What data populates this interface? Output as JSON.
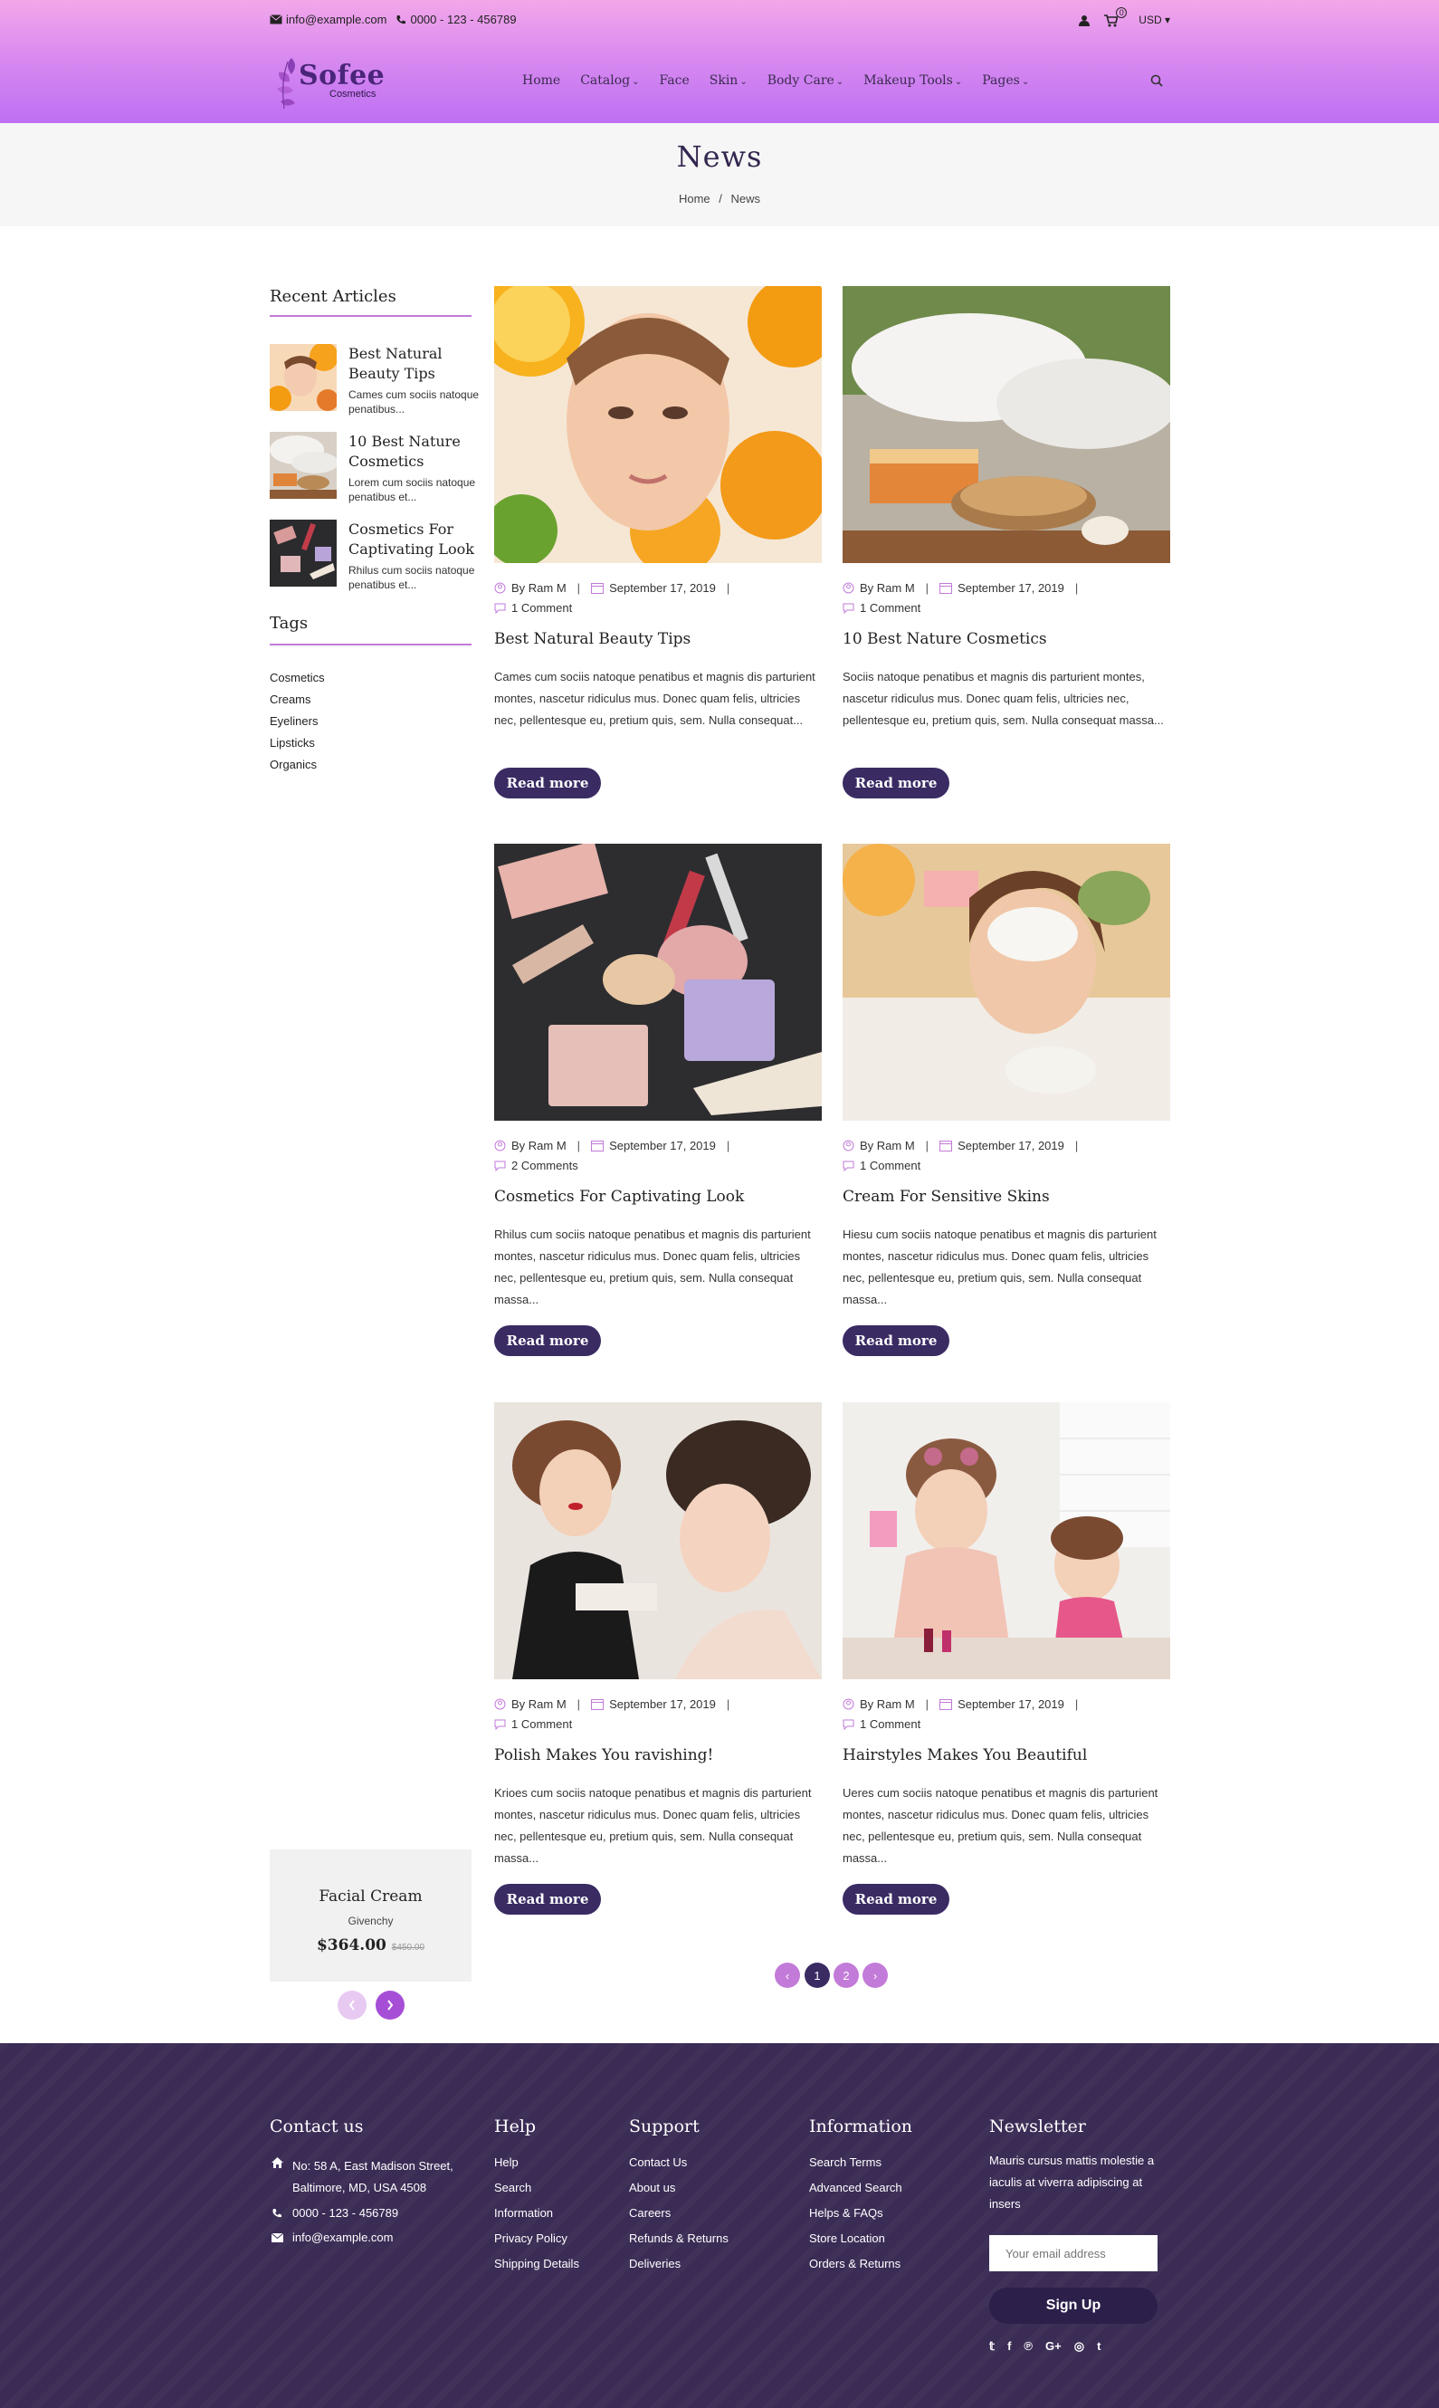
{
  "topbar": {
    "email": "info@example.com",
    "phone": "0000 - 123 - 456789",
    "cart_count": "0",
    "currency": "USD"
  },
  "brand": {
    "name": "Sofee",
    "sub": "Cosmetics"
  },
  "nav": [
    {
      "label": "Home",
      "caret": ""
    },
    {
      "label": "Catalog",
      "caret": "⌄"
    },
    {
      "label": "Face",
      "caret": ""
    },
    {
      "label": "Skin",
      "caret": "⌄"
    },
    {
      "label": "Body Care",
      "caret": "⌄"
    },
    {
      "label": "Makeup Tools",
      "caret": "⌄"
    },
    {
      "label": "Pages",
      "caret": "⌄"
    }
  ],
  "page": {
    "title": "News",
    "breadcrumb": {
      "home": "Home",
      "sep": "/",
      "current": "News"
    }
  },
  "sidebar": {
    "recent_title": "Recent Articles",
    "recent": [
      {
        "title": "Best Natural Beauty Tips",
        "excerpt": "Cames cum sociis natoque penatibus..."
      },
      {
        "title": "10 Best Nature Cosmetics",
        "excerpt": "Lorem cum sociis natoque penatibus et..."
      },
      {
        "title": "Cosmetics For Captivating Look",
        "excerpt": "Rhilus cum sociis natoque penatibus et..."
      }
    ],
    "tags_title": "Tags",
    "tags": [
      "Cosmetics",
      "Creams",
      "Eyeliners",
      "Lipsticks",
      "Organics"
    ],
    "promo": {
      "name": "Facial Cream",
      "brand": "Givenchy",
      "price": "$364.00",
      "old_price": "$450.00"
    }
  },
  "posts": [
    {
      "author": "By Ram M",
      "date": "September 17, 2019",
      "comments": "1 Comment",
      "title": "Best Natural Beauty Tips",
      "excerpt": "Cames cum sociis natoque penatibus et magnis dis parturient montes, nascetur ridiculus mus. Donec quam felis, ultricies nec, pellentesque eu, pretium quis, sem. Nulla consequat...",
      "button": "Read more"
    },
    {
      "author": "By Ram M",
      "date": "September 17, 2019",
      "comments": "1 Comment",
      "title": "10 Best Nature Cosmetics",
      "excerpt": "Sociis natoque penatibus et magnis dis parturient montes, nascetur ridiculus mus. Donec quam felis, ultricies nec, pellentesque eu, pretium quis, sem. Nulla consequat massa...",
      "button": "Read more"
    },
    {
      "author": "By Ram M",
      "date": "September 17, 2019",
      "comments": "2 Comments",
      "title": "Cosmetics For Captivating Look",
      "excerpt": "Rhilus cum sociis natoque penatibus et magnis dis parturient montes, nascetur ridiculus mus. Donec quam felis, ultricies nec, pellentesque eu, pretium quis, sem. Nulla consequat massa...",
      "button": "Read more"
    },
    {
      "author": "By Ram M",
      "date": "September 17, 2019",
      "comments": "1 Comment",
      "title": "Cream For Sensitive Skins",
      "excerpt": "Hiesu cum sociis natoque penatibus et magnis dis parturient montes, nascetur ridiculus mus. Donec quam felis, ultricies nec, pellentesque eu, pretium quis, sem. Nulla consequat massa...",
      "button": "Read more"
    },
    {
      "author": "By Ram M",
      "date": "September 17, 2019",
      "comments": "1 Comment",
      "title": "Polish Makes You ravishing!",
      "excerpt": "Krioes cum sociis natoque penatibus et magnis dis parturient montes, nascetur ridiculus mus. Donec quam felis, ultricies nec, pellentesque eu, pretium quis, sem. Nulla consequat massa...",
      "button": "Read more"
    },
    {
      "author": "By Ram M",
      "date": "September 17, 2019",
      "comments": "1 Comment",
      "title": "Hairstyles Makes You Beautiful",
      "excerpt": "Ueres cum sociis natoque penatibus et magnis dis parturient montes, nascetur ridiculus mus. Donec quam felis, ultricies nec, pellentesque eu, pretium quis, sem. Nulla consequat massa...",
      "button": "Read more"
    }
  ],
  "pagination": {
    "prev": "‹",
    "pages": [
      "1",
      "2"
    ],
    "next": "›"
  },
  "footer": {
    "contact": {
      "title": "Contact us",
      "address": "No: 58 A, East Madison Street, Baltimore, MD, USA 4508",
      "phone": "0000 - 123 - 456789",
      "email": "info@example.com"
    },
    "help": {
      "title": "Help",
      "links": [
        "Help",
        "Search",
        "Information",
        "Privacy Policy",
        "Shipping Details"
      ]
    },
    "support": {
      "title": "Support",
      "links": [
        "Contact Us",
        "About us",
        "Careers",
        "Refunds & Returns",
        "Deliveries"
      ]
    },
    "information": {
      "title": "Information",
      "links": [
        "Search Terms",
        "Advanced Search",
        "Helps & FAQs",
        "Store Location",
        "Orders & Returns"
      ]
    },
    "newsletter": {
      "title": "Newsletter",
      "text": "Mauris cursus mattis molestie a iaculis at viverra adipiscing at insers",
      "placeholder": "Your email address",
      "button": "Sign Up"
    }
  },
  "colors": {
    "accent": "#c27bd8",
    "dark": "#3a2b63",
    "footer": "#3b2c55",
    "header_top": "#f3a7e9",
    "header_bottom": "#be6ff2"
  }
}
